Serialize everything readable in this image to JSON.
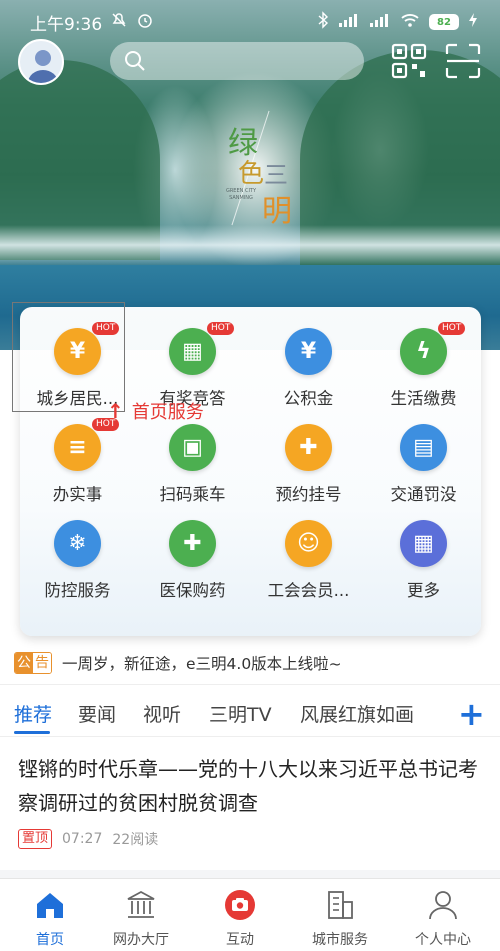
{
  "status_bar": {
    "time": "上午9:36",
    "battery": "82"
  },
  "banner": {
    "title_chars": [
      "绿",
      "色",
      "三",
      "明"
    ],
    "title_en": "GREEN CITY SANMING"
  },
  "services": [
    {
      "label": "城乡居民...",
      "hot": true,
      "color": "#f5a623",
      "icon": "id-card-icon",
      "glyph": "¥"
    },
    {
      "label": "有奖竞答",
      "hot": true,
      "color": "#4caf50",
      "icon": "gift-icon",
      "glyph": "▦"
    },
    {
      "label": "公积金",
      "hot": false,
      "color": "#3d8fe0",
      "icon": "house-fund-icon",
      "glyph": "¥"
    },
    {
      "label": "生活缴费",
      "hot": true,
      "color": "#4caf50",
      "icon": "utility-bill-icon",
      "glyph": "ϟ"
    },
    {
      "label": "办实事",
      "hot": true,
      "color": "#f5a623",
      "icon": "document-icon",
      "glyph": "≡"
    },
    {
      "label": "扫码乘车",
      "hot": false,
      "color": "#4caf50",
      "icon": "qr-bus-icon",
      "glyph": "▣"
    },
    {
      "label": "预约挂号",
      "hot": false,
      "color": "#f5a623",
      "icon": "hospital-icon",
      "glyph": "✚"
    },
    {
      "label": "交通罚没",
      "hot": false,
      "color": "#3d8fe0",
      "icon": "traffic-fine-icon",
      "glyph": "▤"
    },
    {
      "label": "防控服务",
      "hot": false,
      "color": "#3d8fe0",
      "icon": "snowflake-icon",
      "glyph": "❄"
    },
    {
      "label": "医保购药",
      "hot": false,
      "color": "#4caf50",
      "icon": "medicine-icon",
      "glyph": "✚"
    },
    {
      "label": "工会会员...",
      "hot": false,
      "color": "#f5a623",
      "icon": "member-icon",
      "glyph": "☺"
    },
    {
      "label": "更多",
      "hot": false,
      "color": "#5b6fd9",
      "icon": "more-grid-icon",
      "glyph": "▦"
    }
  ],
  "hot_label": "HOT",
  "annotation": {
    "text": "首页服务"
  },
  "notice": {
    "badge_1": "公",
    "badge_2": "告",
    "text": "一周岁，新征途，e三明4.0版本上线啦~"
  },
  "tabs": [
    {
      "label": "推荐",
      "active": true
    },
    {
      "label": "要闻",
      "active": false
    },
    {
      "label": "视听",
      "active": false
    },
    {
      "label": "三明TV",
      "active": false
    },
    {
      "label": "风展红旗如画",
      "active": false
    }
  ],
  "article": {
    "title": "铿锵的时代乐章——党的十八大以来习近平总书记考察调研过的贫困村脱贫调查",
    "badge": "置顶",
    "time": "07:27",
    "reads": "22阅读"
  },
  "bottom_nav": [
    {
      "label": "首页",
      "icon": "home-icon",
      "active": true
    },
    {
      "label": "网办大厅",
      "icon": "government-hall-icon",
      "active": false
    },
    {
      "label": "互动",
      "icon": "camera-icon",
      "active": false
    },
    {
      "label": "城市服务",
      "icon": "city-building-icon",
      "active": false
    },
    {
      "label": "个人中心",
      "icon": "person-icon",
      "active": false
    }
  ],
  "colors": {
    "accent": "#1e6fd9",
    "hot": "#e53935",
    "notice": "#e8912d"
  }
}
